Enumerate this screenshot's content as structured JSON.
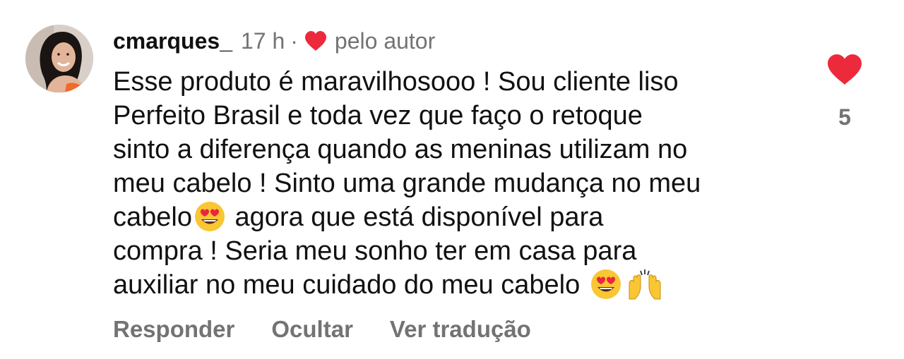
{
  "comment": {
    "username": "cmarques_",
    "time": "17 h",
    "separator": "·",
    "liked_by_author_label": "pelo autor",
    "text_part1": "Esse produto é maravilhosooo ! Sou cliente liso\nPerfeito Brasil e toda vez que faço o retoque\nsinto a diferença quando as meninas utilizam no\nmeu cabelo ! Sinto uma grande mudança no meu\ncabelo",
    "text_part2": " agora que está disponível para\ncompra ! Seria meu sonho ter em casa para\nauxiliar no meu cuidado do meu cabelo",
    "like_count": "5",
    "heart_color": "#ED2A3B"
  },
  "icons": {
    "avatar": "profile-photo",
    "author_heart": "heart-icon",
    "like_heart": "heart-icon",
    "emoji_1": "heart-eyes-emoji",
    "emoji_2": "heart-eyes-emoji",
    "emoji_3": "raising-hands-emoji"
  },
  "actions": {
    "reply": "Responder",
    "hide": "Ocultar",
    "translate": "Ver tradução"
  }
}
